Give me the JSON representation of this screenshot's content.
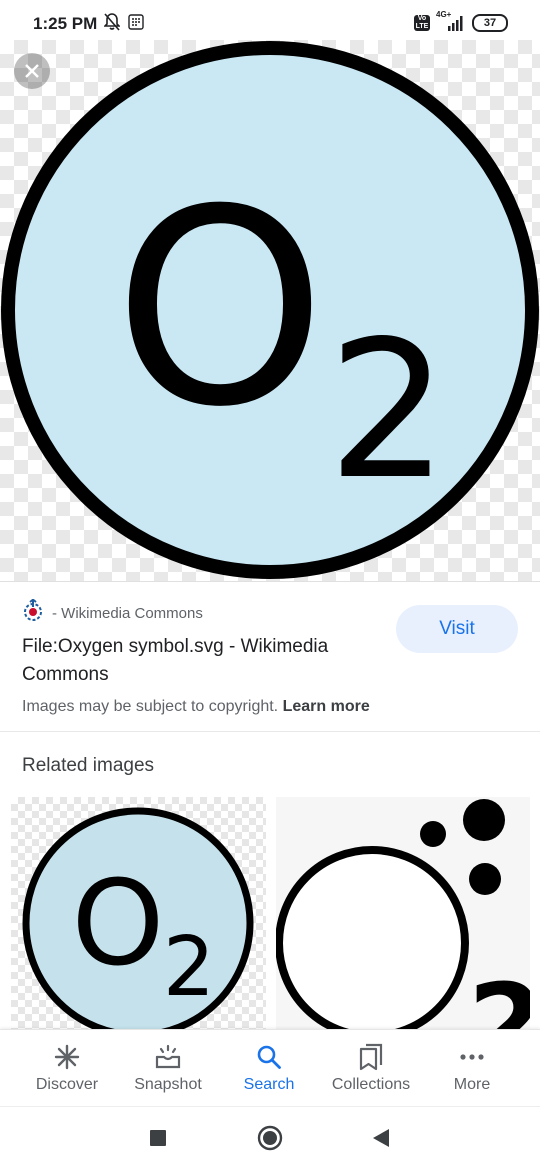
{
  "status_bar": {
    "time": "1:25 PM",
    "network": "4G+",
    "battery": "37",
    "icons": [
      "mute-bell-icon",
      "notification-app-icon",
      "volte-icon",
      "signal-icon",
      "battery-icon"
    ]
  },
  "hero": {
    "main_text": "O",
    "subscript": "2",
    "circle_fill": "#c9e8f4",
    "stroke": "#000000"
  },
  "result": {
    "source": "- Wikimedia Commons",
    "title": "File:Oxygen symbol.svg - Wikimedia Commons",
    "visit_label": "Visit",
    "copyright_text": "Images may be subject to copyright.",
    "learn_more": "Learn more"
  },
  "related": {
    "title": "Related images",
    "thumb1": {
      "main_text": "O",
      "subscript": "2"
    },
    "thumb2": {
      "subscript": "2"
    }
  },
  "bottom_nav": {
    "items": [
      {
        "label": "Discover",
        "icon": "asterisk-icon"
      },
      {
        "label": "Snapshot",
        "icon": "snapshot-icon"
      },
      {
        "label": "Search",
        "icon": "search-icon",
        "active": true
      },
      {
        "label": "Collections",
        "icon": "collections-icon"
      },
      {
        "label": "More",
        "icon": "more-dots-icon"
      }
    ]
  },
  "colors": {
    "accent": "#1a73e8",
    "visit_bg": "#e8f0fe"
  }
}
